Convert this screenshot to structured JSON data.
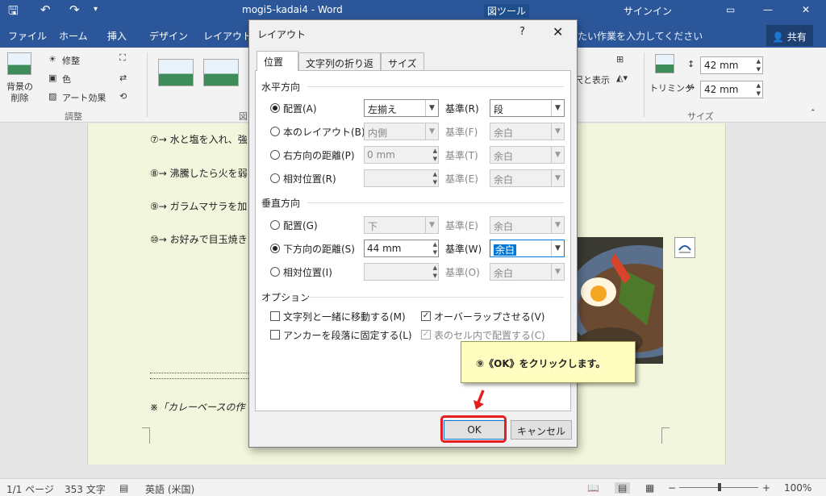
{
  "titlebar": {
    "doc_title": "mogi5-kadai4 - Word",
    "context_tab": "図ツール",
    "signin": "サインイン"
  },
  "menu": {
    "tabs": [
      "ファイル",
      "ホーム",
      "挿入",
      "デザイン",
      "レイアウト"
    ],
    "tellme": "たい作業を入力してください",
    "share": "共有"
  },
  "ribbon": {
    "remove_bg": "背景の\n削除",
    "corrections": "修整",
    "color": "色",
    "artistic": "アート効果",
    "group_adjust": "調整",
    "group_styles": "図",
    "wrap_text": "尺と表示",
    "crop": "トリミング",
    "height": "42 mm",
    "width": "42 mm",
    "group_size": "サイズ"
  },
  "document": {
    "lines": [
      "⑦→ 水と塩を入れ、強",
      "⑧→ 沸騰したら火を弱",
      "⑨→ ガラムマサラを加",
      "⑩→ お好みで目玉焼き"
    ],
    "footnote": "※「カレーベースの作"
  },
  "dialog": {
    "title": "レイアウト",
    "help": "?",
    "close": "✕",
    "tabs": [
      "位置",
      "文字列の折り返し",
      "サイズ"
    ],
    "horizontal": {
      "heading": "水平方向",
      "rows": [
        {
          "label": "配置(A)",
          "value": "左揃え",
          "base_label": "基準(R)",
          "base_value": "段"
        },
        {
          "label": "本のレイアウト(B)",
          "value": "内側",
          "base_label": "基準(F)",
          "base_value": "余白"
        },
        {
          "label": "右方向の距離(P)",
          "value": "0 mm",
          "base_label": "基準(T)",
          "base_value": "余白"
        },
        {
          "label": "相対位置(R)",
          "value": "",
          "base_label": "基準(E)",
          "base_value": "余白"
        }
      ]
    },
    "vertical": {
      "heading": "垂直方向",
      "rows": [
        {
          "label": "配置(G)",
          "value": "下",
          "base_label": "基準(E)",
          "base_value": "余白"
        },
        {
          "label": "下方向の距離(S)",
          "value": "44 mm",
          "base_label": "基準(W)",
          "base_value": "余白"
        },
        {
          "label": "相対位置(I)",
          "value": "",
          "base_label": "基準(O)",
          "base_value": "余白"
        }
      ]
    },
    "options": {
      "heading": "オプション",
      "move_with_text": "文字列と一緒に移動する(M)",
      "lock_anchor": "アンカーを段落に固定する(L)",
      "allow_overlap": "オーバーラップさせる(V)",
      "layout_in_cell": "表のセル内で配置する(C)"
    },
    "ok": "OK",
    "cancel": "キャンセル"
  },
  "callout": "⑨《OK》をクリックします。",
  "status": {
    "page": "1/1 ページ",
    "words": "353 文字",
    "lang": "英語 (米国)",
    "zoom": "100%"
  }
}
